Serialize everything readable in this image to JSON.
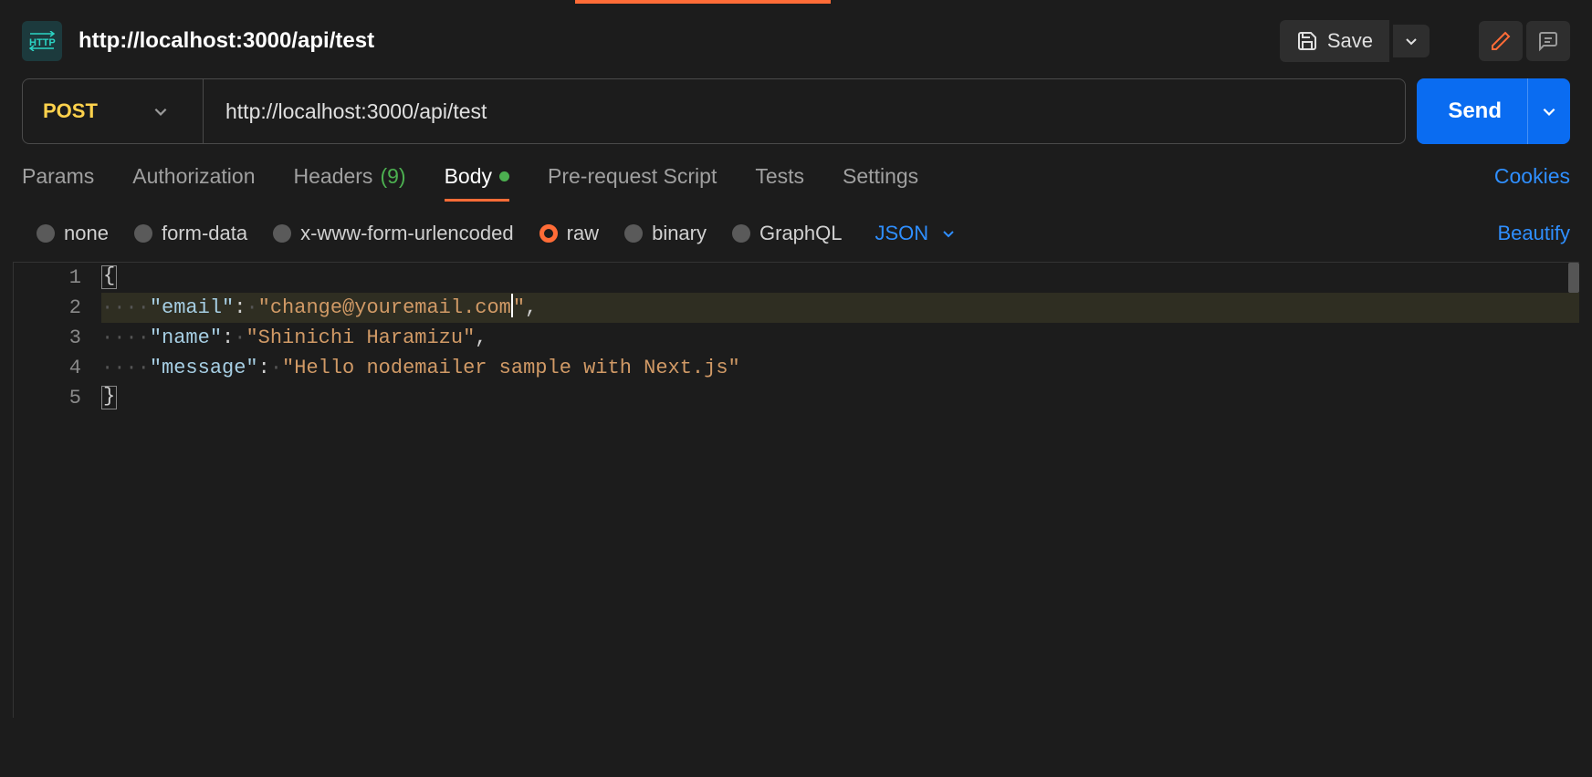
{
  "header": {
    "title": "http://localhost:3000/api/test",
    "save_label": "Save"
  },
  "request": {
    "method": "POST",
    "url": "http://localhost:3000/api/test",
    "send_label": "Send"
  },
  "tabs": {
    "params": "Params",
    "authorization": "Authorization",
    "headers": "Headers",
    "headers_count": "(9)",
    "body": "Body",
    "prerequest": "Pre-request Script",
    "tests": "Tests",
    "settings": "Settings",
    "cookies": "Cookies"
  },
  "bodytype": {
    "none": "none",
    "formdata": "form-data",
    "xwww": "x-www-form-urlencoded",
    "raw": "raw",
    "binary": "binary",
    "graphql": "GraphQL",
    "format": "JSON",
    "beautify": "Beautify"
  },
  "editor": {
    "lines": [
      "1",
      "2",
      "3",
      "4",
      "5"
    ],
    "l1_brace": "{",
    "l2_key": "\"email\"",
    "l2_colon": ":",
    "l2_val_a": "\"change@youremail.com",
    "l2_val_b": "\"",
    "l2_comma": ",",
    "l3_key": "\"name\"",
    "l3_colon": ":",
    "l3_val": "\"Shinichi Haramizu\"",
    "l3_comma": ",",
    "l4_key": "\"message\"",
    "l4_colon": ":",
    "l4_val": "\"Hello nodemailer sample with Next.js\"",
    "l5_brace": "}",
    "ws4": "····",
    "ws1": "·"
  }
}
